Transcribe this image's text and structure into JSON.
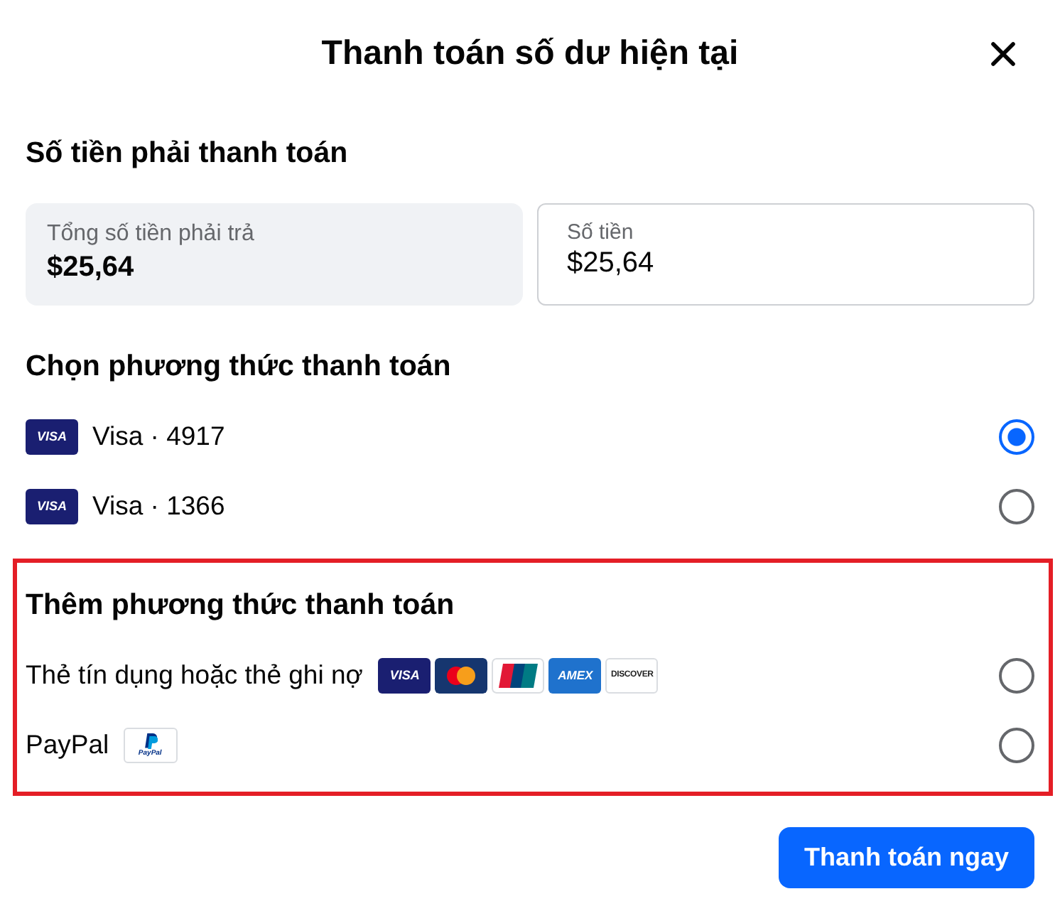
{
  "dialog": {
    "title": "Thanh toán số dư hiện tại"
  },
  "amount_section": {
    "heading": "Số tiền phải thanh toán",
    "total": {
      "label": "Tổng số tiền phải trả",
      "value": "$25,64"
    },
    "amount_field": {
      "label": "Số tiền",
      "value": "$25,64"
    }
  },
  "saved_methods": {
    "heading": "Chọn phương thức thanh toán",
    "items": [
      {
        "logo": {
          "kind": "visa",
          "text": "VISA"
        },
        "label": "Visa · 4917",
        "selected": true
      },
      {
        "logo": {
          "kind": "visa",
          "text": "VISA"
        },
        "label": "Visa · 1366",
        "selected": false
      }
    ]
  },
  "add_methods": {
    "highlighted": true,
    "heading": "Thêm phương thức thanh toán",
    "items": [
      {
        "label": "Thẻ tín dụng hoặc thẻ ghi nợ",
        "logos": [
          {
            "kind": "visa",
            "text": "VISA"
          },
          {
            "kind": "mastercard"
          },
          {
            "kind": "unionpay"
          },
          {
            "kind": "amex",
            "text": "AMEX"
          },
          {
            "kind": "discover",
            "text": "DISCOVER"
          }
        ],
        "selected": false
      },
      {
        "label": "PayPal",
        "logos": [
          {
            "kind": "paypal",
            "text": "PayPal"
          }
        ],
        "selected": false
      }
    ]
  },
  "submit_button": {
    "label": "Thanh toán ngay"
  }
}
